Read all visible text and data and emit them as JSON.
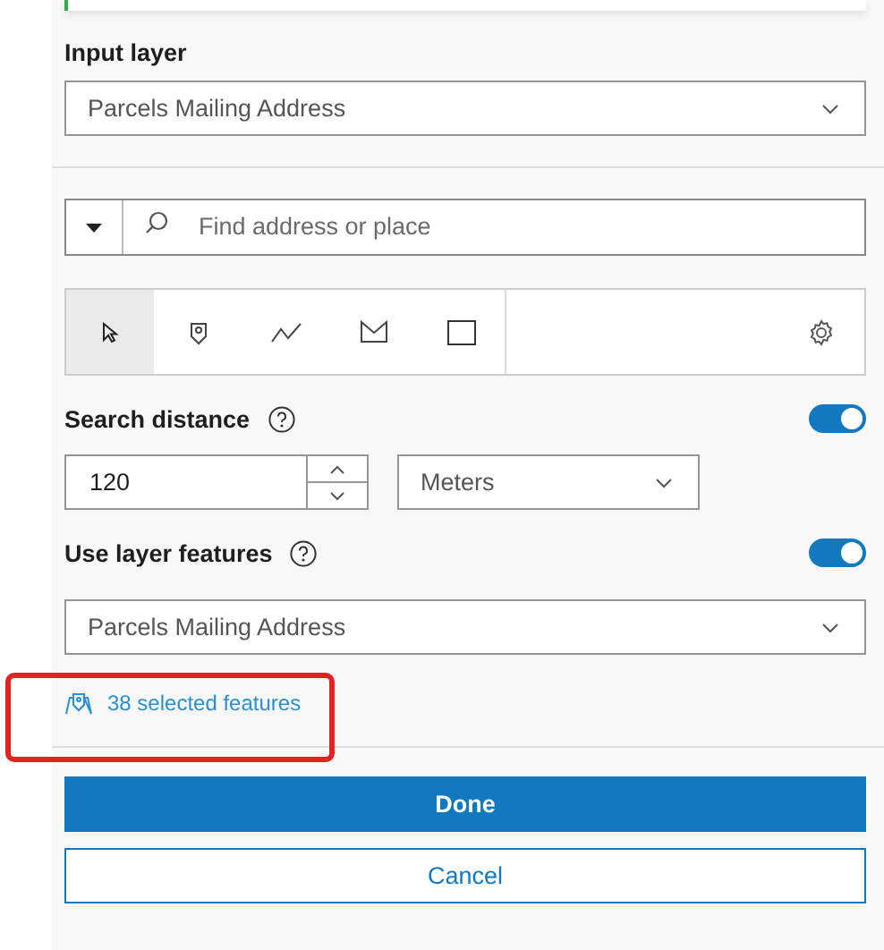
{
  "input_layer": {
    "label": "Input layer",
    "value": "Parcels Mailing Address"
  },
  "search": {
    "placeholder": "Find address or place"
  },
  "tools": [
    {
      "kind": "select",
      "selected": true
    },
    {
      "kind": "point",
      "selected": false
    },
    {
      "kind": "polyline",
      "selected": false
    },
    {
      "kind": "polygon",
      "selected": false
    },
    {
      "kind": "rectangle",
      "selected": false
    }
  ],
  "search_distance": {
    "label": "Search distance",
    "on": true,
    "value": "120",
    "unit": "Meters"
  },
  "layer_features": {
    "label": "Use layer features",
    "on": true,
    "value": "Parcels Mailing Address"
  },
  "selected_link": "38 selected features",
  "buttons": [
    {
      "kind": "primary",
      "label": "Done"
    },
    {
      "kind": "secondary",
      "label": "Cancel"
    }
  ]
}
